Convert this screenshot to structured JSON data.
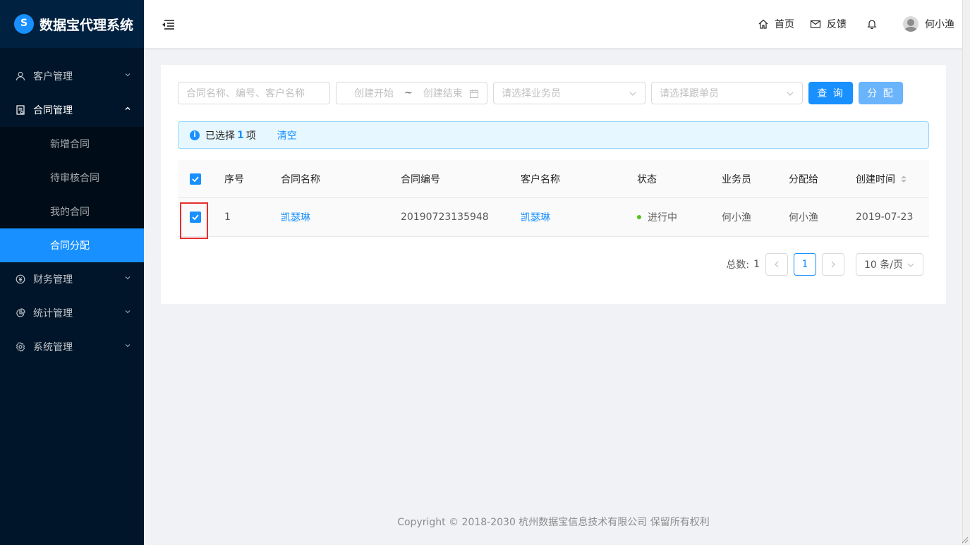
{
  "app": {
    "title": "数据宝代理系统"
  },
  "sidebar": {
    "items": [
      {
        "label": "客户管理",
        "icon": "user-icon"
      },
      {
        "label": "合同管理",
        "icon": "contract-icon",
        "open": true,
        "children": [
          {
            "label": "新增合同"
          },
          {
            "label": "待审核合同"
          },
          {
            "label": "我的合同"
          },
          {
            "label": "合同分配",
            "active": true
          }
        ]
      },
      {
        "label": "财务管理",
        "icon": "finance-icon"
      },
      {
        "label": "统计管理",
        "icon": "pie-chart-icon"
      },
      {
        "label": "系统管理",
        "icon": "gear-icon"
      }
    ]
  },
  "header": {
    "home_label": "首页",
    "feedback_label": "反馈",
    "username": "何小渔"
  },
  "filters": {
    "search_placeholder": "合同名称、编号、客户名称",
    "date_start_placeholder": "创建开始",
    "date_separator": "~",
    "date_end_placeholder": "创建结束",
    "salesman_placeholder": "请选择业务员",
    "follower_placeholder": "请选择跟单员",
    "query_label": "查 询",
    "assign_label": "分 配"
  },
  "alert": {
    "prefix": "已选择",
    "count": "1",
    "suffix": "项",
    "clear_label": "清空"
  },
  "table": {
    "columns": [
      "序号",
      "合同名称",
      "合同编号",
      "客户名称",
      "状态",
      "业务员",
      "分配给",
      "创建时间"
    ],
    "rows": [
      {
        "index": "1",
        "contract_name": "凯瑟琳",
        "contract_no": "20190723135948",
        "customer": "凯瑟琳",
        "status": "进行中",
        "salesman": "何小渔",
        "assigned_to": "何小渔",
        "created": "2019-07-23",
        "checked": true
      }
    ]
  },
  "pagination": {
    "total_label": "总数:",
    "total": "1",
    "current_page": "1",
    "page_size_label": "10 条/页"
  },
  "footer": {
    "copyright": "Copyright",
    "text": "2018-2030 杭州数据宝信息技术有限公司 保留所有权利"
  },
  "colors": {
    "primary": "#1890ff",
    "sidebar_bg": "#001529",
    "status_running": "#52c41a",
    "highlight": "#e62e2e"
  }
}
